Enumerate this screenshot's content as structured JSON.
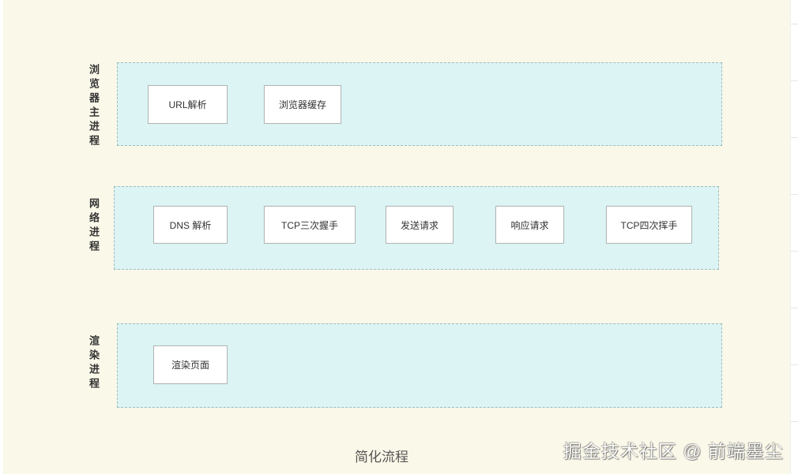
{
  "diagram": {
    "caption": "简化流程",
    "lanes": [
      {
        "label": "浏览器主进程",
        "steps": [
          "URL解析",
          "浏览器缓存"
        ]
      },
      {
        "label": "网络进程",
        "steps": [
          "DNS 解析",
          "TCP三次握手",
          "发送请求",
          "响应请求",
          "TCP四次挥手"
        ]
      },
      {
        "label": "渲染进程",
        "steps": [
          "渲染页面"
        ]
      }
    ]
  },
  "watermark": "掘金技术社区 @ 前端墨尘",
  "colors": {
    "background": "#faf8e9",
    "lane_fill": "#dcf4f4",
    "lane_border": "#9dbdbd",
    "box_border": "#b5b5b5"
  }
}
